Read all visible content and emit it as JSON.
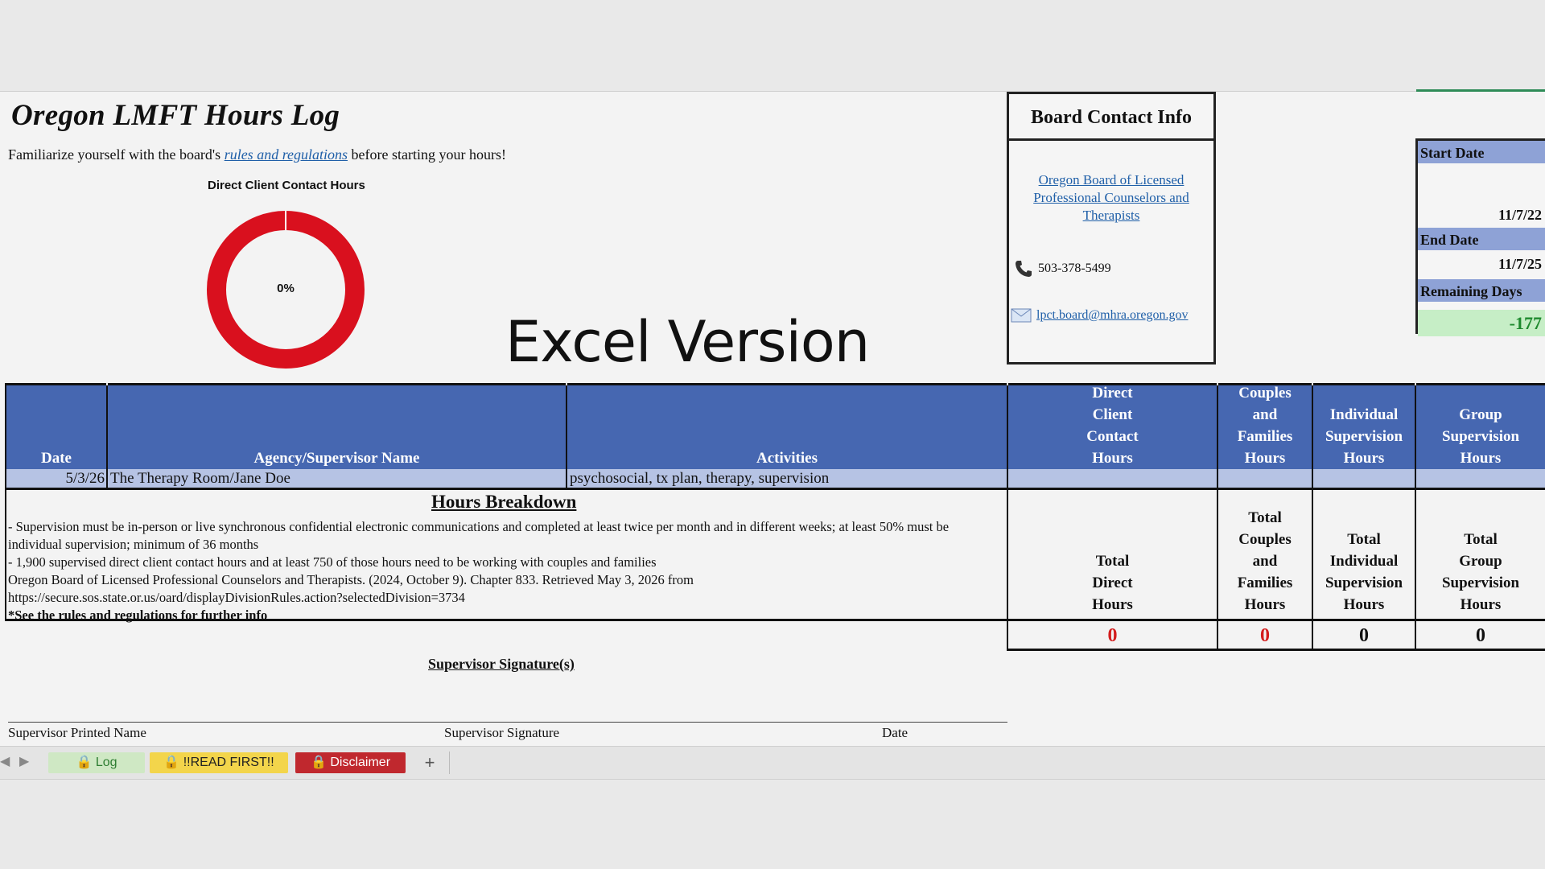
{
  "header": {
    "title": "Oregon LMFT Hours Log",
    "intro_before": "Familiarize yourself with the board's ",
    "intro_link": "rules and regulations",
    "intro_after": " before starting your hours!"
  },
  "chart_data": {
    "type": "pie",
    "title": "Direct Client Contact Hours",
    "center_label": "0%",
    "percent_complete": 0,
    "colors": {
      "remaining": "#d9101e",
      "complete": "#2e7d32"
    }
  },
  "watermark": "Excel Version",
  "board": {
    "title": "Board Contact Info",
    "link": "Oregon Board of Licensed Professional Counselors and Therapists",
    "phone": "503-378-5499",
    "email": "lpct.board@mhra.oregon.gov"
  },
  "dates": {
    "start_label": "Start Date",
    "start_value": "11/7/22",
    "end_label": "End Date",
    "end_value": "11/7/25",
    "remaining_label": "Remaining Days",
    "remaining_value": "-177"
  },
  "table": {
    "headers": {
      "date": "Date",
      "agency": "Agency/Supervisor Name",
      "activities": "Activities",
      "direct": [
        "Direct",
        "Client",
        "Contact",
        "Hours"
      ],
      "couples": [
        "Couples",
        "and",
        "Families",
        "Hours"
      ],
      "individual": [
        "Individual",
        "Supervision",
        "Hours"
      ],
      "group": [
        "Group",
        "Supervision",
        "Hours"
      ]
    },
    "rows": [
      {
        "date": "5/3/26",
        "agency": "The Therapy Room/Jane Doe",
        "activities": "psychosocial, tx plan, therapy, supervision",
        "direct": "",
        "couples": "",
        "individual": "",
        "group": ""
      }
    ]
  },
  "breakdown": {
    "title": "Hours Breakdown",
    "lines": [
      "- Supervision must be in-person or live synchronous confidential electronic communications and completed at least twice per month and in different weeks; at least 50% must be individual supervision; minimum of 36 months",
      "- 1,900 supervised direct client contact hours and at least 750 of those hours need to be working with couples and families",
      "Oregon Board of Licensed Professional Counselors and Therapists. (2024, October 9). Chapter 833. Retrieved May 3, 2026 from https://secure.sos.state.or.us/oard/displayDivisionRules.action?selectedDivision=3734",
      "*See the rules and regulations for further info"
    ]
  },
  "totals": {
    "direct_label": [
      "Total",
      "Direct",
      "Hours"
    ],
    "couples_label": [
      "Total",
      "Couples",
      "and",
      "Families",
      "Hours"
    ],
    "individual_label": [
      "Total",
      "Individual",
      "Supervision",
      "Hours"
    ],
    "group_label": [
      "Total",
      "Group",
      "Supervision",
      "Hours"
    ],
    "direct": "0",
    "couples": "0",
    "individual": "0",
    "group": "0"
  },
  "signature": {
    "title": "Supervisor Signature(s)",
    "printed_name": "Supervisor Printed Name",
    "signature": "Supervisor Signature",
    "date": "Date"
  },
  "tabs": [
    {
      "label": "Log",
      "bg": "#cfe8c4",
      "color": "#2e7d32"
    },
    {
      "label": "!!READ FIRST!!",
      "bg": "#f3d54b",
      "color": "#222"
    },
    {
      "label": "Disclaimer",
      "bg": "#c0282e",
      "color": "#ffffff"
    }
  ],
  "add_sheet": "+"
}
